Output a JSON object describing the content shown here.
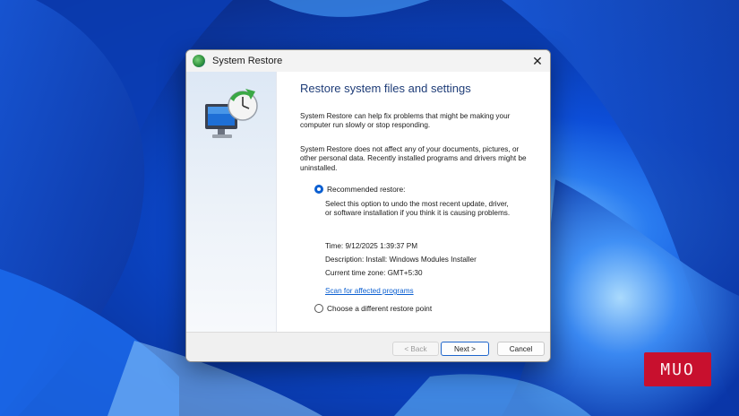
{
  "window": {
    "title": "System Restore",
    "close_glyph": "✕"
  },
  "content": {
    "heading": "Restore system files and settings",
    "paragraph1": "System Restore can help fix problems that might be making your computer run slowly or stop responding.",
    "paragraph2": "System Restore does not affect any of your documents, pictures, or other personal data. Recently installed programs and drivers might be uninstalled.",
    "options": {
      "recommended": {
        "label": "Recommended restore:",
        "checked": true,
        "description": "Select this option to undo the most recent update, driver, or software installation if you think it is causing problems."
      },
      "different": {
        "label": "Choose a different restore point",
        "checked": false
      }
    },
    "restore_info": {
      "time": "Time: 9/12/2025 1:39:37 PM",
      "description": "Description: Install: Windows Modules Installer",
      "timezone": "Current time zone: GMT+5:30"
    },
    "scan_link": "Scan for affected programs"
  },
  "buttons": {
    "back": "< Back",
    "next": "Next >",
    "cancel": "Cancel"
  },
  "logo": {
    "text": "MUO",
    "color": "#c8102e"
  },
  "icons": {
    "title": "system-restore-icon",
    "sidebar": "computer-clock-restore-icon"
  },
  "colors": {
    "accent": "#0b5fd1",
    "heading": "#1f3d78"
  }
}
